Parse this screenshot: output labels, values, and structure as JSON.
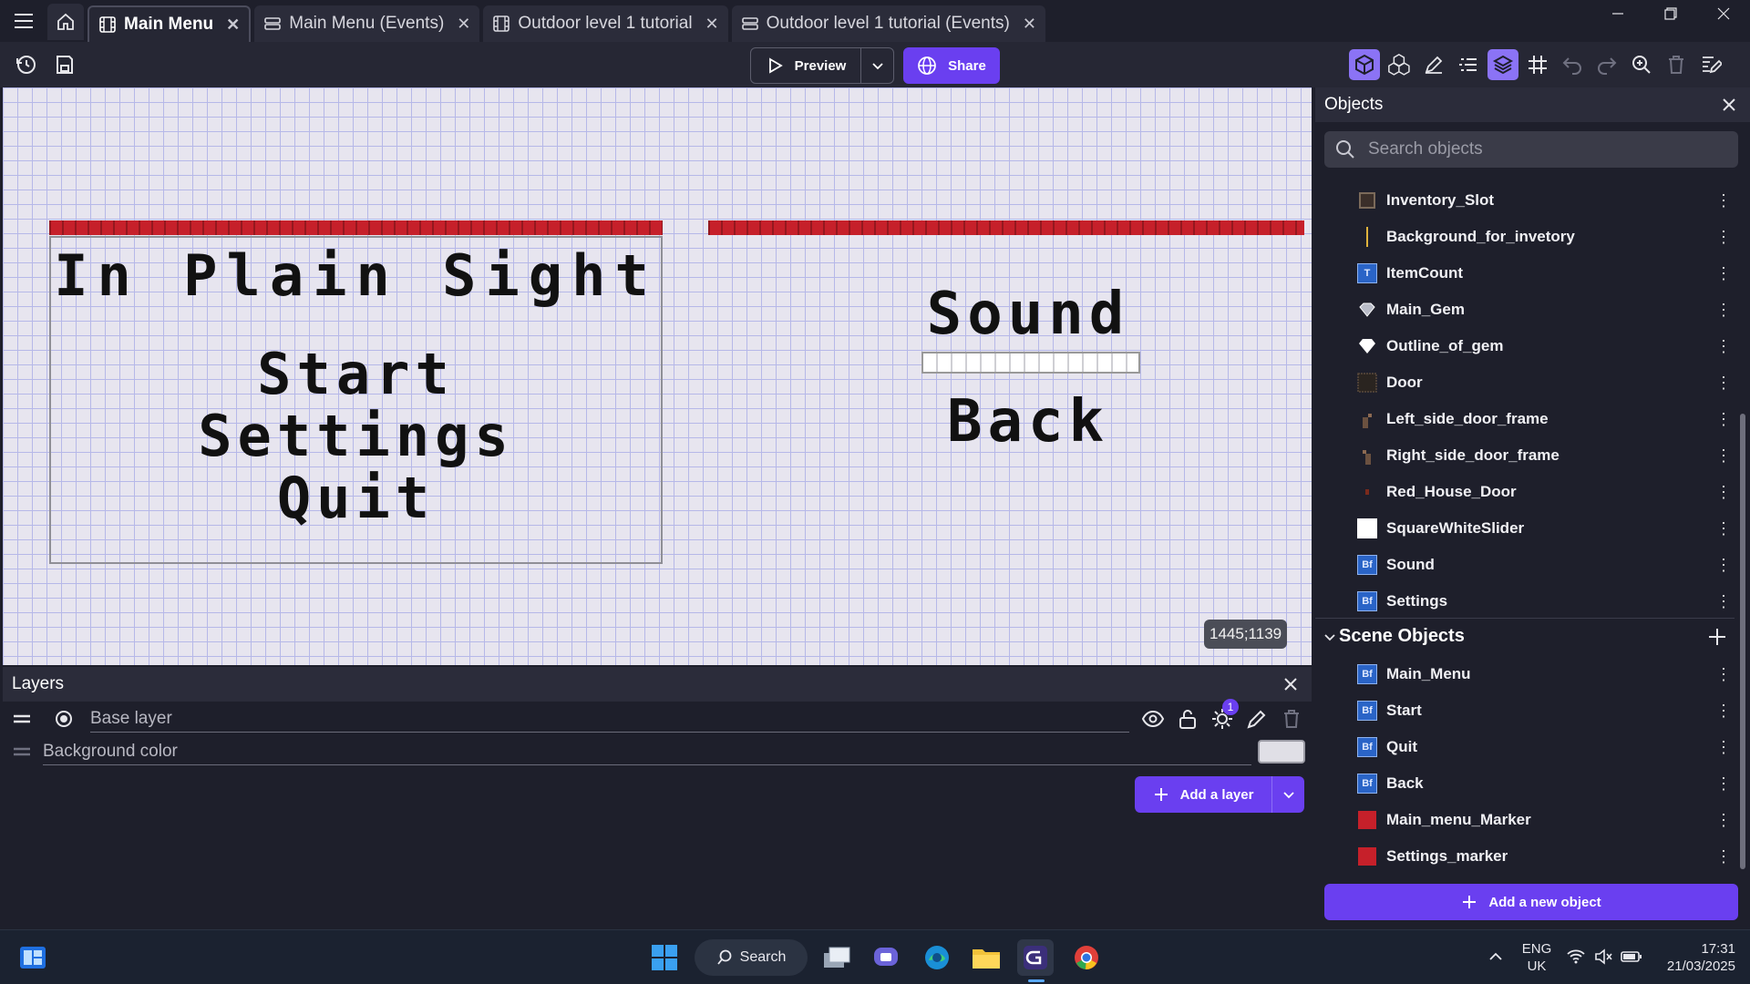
{
  "tabs": [
    {
      "label": "Main Menu",
      "active": true
    },
    {
      "label": "Main Menu (Events)",
      "active": false
    },
    {
      "label": "Outdoor level 1 tutorial",
      "active": false
    },
    {
      "label": "Outdoor level 1 tutorial (Events)",
      "active": false
    }
  ],
  "toolbar": {
    "preview_label": "Preview",
    "share_label": "Share"
  },
  "canvas": {
    "title": "In Plain Sight",
    "menu_items": [
      "Start",
      "Settings",
      "Quit"
    ],
    "settings_title": "Sound",
    "settings_back": "Back",
    "coordinates": "1445;1139"
  },
  "layers": {
    "title": "Layers",
    "items": [
      {
        "name": "Base layer",
        "effects_count": "1"
      },
      {
        "name": "Background color"
      }
    ],
    "add_label": "Add a layer"
  },
  "objects": {
    "title": "Objects",
    "search_placeholder": "Search objects",
    "items": [
      {
        "name": "Inventory_Slot",
        "icon": "slot-icon"
      },
      {
        "name": "Background_for_invetory",
        "icon": "bar-icon"
      },
      {
        "name": "ItemCount",
        "icon": "text-object-icon"
      },
      {
        "name": "Main_Gem",
        "icon": "gem-icon"
      },
      {
        "name": "Outline_of_gem",
        "icon": "gem-outline-icon"
      },
      {
        "name": "Door",
        "icon": "door-icon"
      },
      {
        "name": "Left_side_door_frame",
        "icon": "frame-left-icon"
      },
      {
        "name": "Right_side_door_frame",
        "icon": "frame-right-icon"
      },
      {
        "name": "Red_House_Door",
        "icon": "red-door-icon"
      },
      {
        "name": "SquareWhiteSlider",
        "icon": "white-square-icon"
      },
      {
        "name": "Sound",
        "icon": "bitmap-font-icon"
      },
      {
        "name": "Settings",
        "icon": "bitmap-font-icon"
      }
    ],
    "scene_title": "Scene Objects",
    "scene_items": [
      {
        "name": "Main_Menu",
        "icon": "bitmap-font-icon"
      },
      {
        "name": "Start",
        "icon": "bitmap-font-icon"
      },
      {
        "name": "Quit",
        "icon": "bitmap-font-icon"
      },
      {
        "name": "Back",
        "icon": "bitmap-font-icon"
      },
      {
        "name": "Main_menu_Marker",
        "icon": "red-square-icon"
      },
      {
        "name": "Settings_marker",
        "icon": "red-square-icon"
      }
    ],
    "bf_glyph": "Bf",
    "text_glyph": "T",
    "add_label": "Add a new object"
  },
  "taskbar": {
    "search_label": "Search",
    "lang": "ENG",
    "region": "UK",
    "time": "17:31",
    "date": "21/03/2025"
  },
  "colors": {
    "accent": "#6a3ff0",
    "marker": "#c6202a",
    "canvas_bg": "#e7e5ef",
    "panel_bg": "#1e1f2b"
  }
}
